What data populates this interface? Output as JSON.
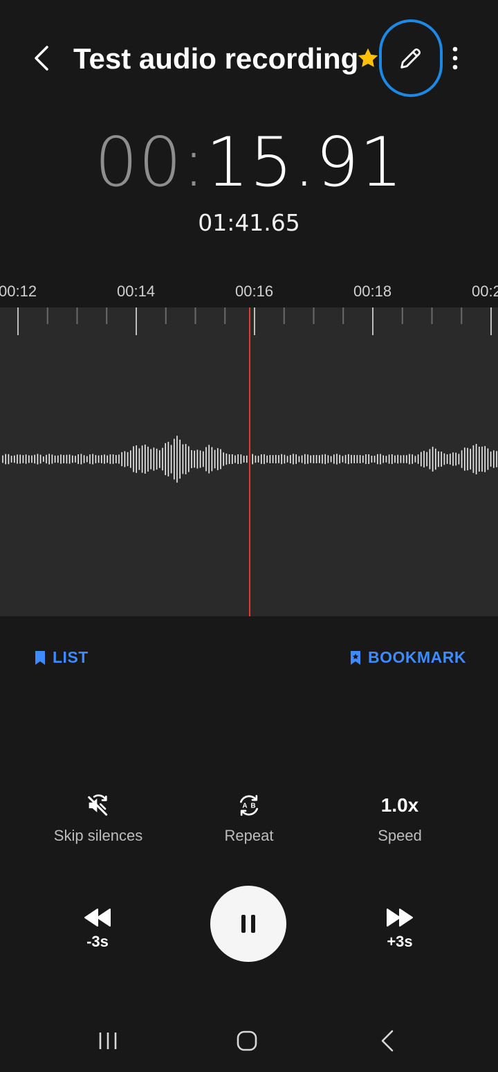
{
  "header": {
    "title": "Test audio recording",
    "back_icon": "chevron-left-icon",
    "favorite_icon": "star-icon",
    "edit_icon": "pencil-icon",
    "more_icon": "more-vertical-icon",
    "favorite_color": "#ffc107",
    "highlight_color": "#1e88e5"
  },
  "timer": {
    "current_minutes": "00",
    "current_separator": ":",
    "current_seconds": "15.91",
    "total": "01:41.65"
  },
  "timeline": {
    "labels": [
      "00:12",
      "00:14",
      "00:16",
      "00:18",
      "00:2"
    ],
    "playhead_color": "#e53935"
  },
  "actions": {
    "list_label": "LIST",
    "bookmark_label": "BOOKMARK",
    "accent_color": "#3d8bff"
  },
  "options": {
    "skip_label": "Skip silences",
    "repeat_label": "Repeat",
    "speed_value": "1.0x",
    "speed_label": "Speed"
  },
  "playback": {
    "rewind_label": "-3s",
    "forward_label": "+3s",
    "state": "playing"
  },
  "navbar": {
    "recents_icon": "recents-icon",
    "home_icon": "home-icon",
    "back_icon": "back-icon"
  }
}
